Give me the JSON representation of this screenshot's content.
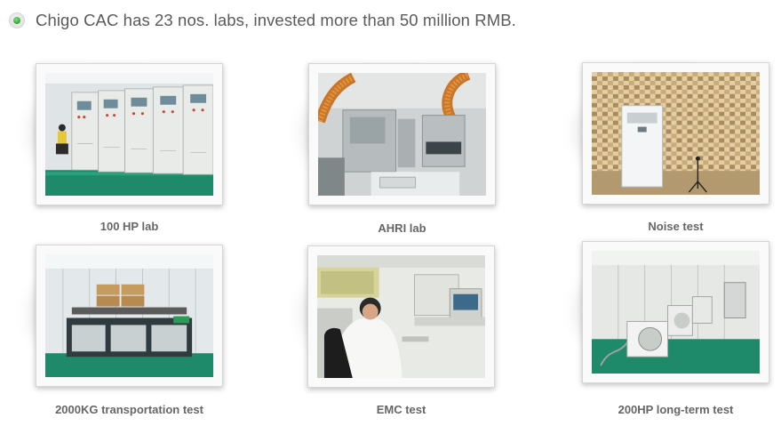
{
  "header": {
    "text": "Chigo CAC has 23 nos. labs, invested more than 50 million RMB.",
    "bullet_icon": "green-dot-bullet-icon",
    "accent_color": "#2fa52f"
  },
  "labs": [
    {
      "caption": "100 HP lab",
      "photo": "control-cabinets-photo"
    },
    {
      "caption": "AHRI lab",
      "photo": "test-chamber-ducts-photo"
    },
    {
      "caption": "Noise test",
      "photo": "anechoic-room-photo"
    },
    {
      "caption": "2000KG transportation test",
      "photo": "vibration-table-photo"
    },
    {
      "caption": "EMC test",
      "photo": "technician-workstation-photo"
    },
    {
      "caption": "200HP long-term test",
      "photo": "outdoor-units-hall-photo"
    }
  ]
}
